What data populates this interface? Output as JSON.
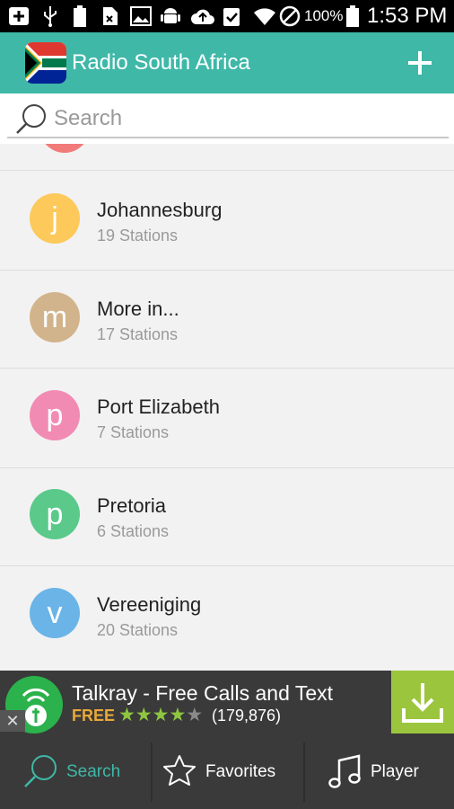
{
  "status_bar": {
    "battery_percent": "100%",
    "time": "1:53 PM"
  },
  "app": {
    "title": "Radio South Africa",
    "accent_color": "#3fb8a8"
  },
  "search": {
    "placeholder": "Search"
  },
  "cities": [
    {
      "letter": "j",
      "name": "Johannesburg",
      "count": "19 Stations",
      "color": "#fcc95a"
    },
    {
      "letter": "m",
      "name": "More in...",
      "count": "17 Stations",
      "color": "#d2b48c"
    },
    {
      "letter": "p",
      "name": "Port Elizabeth",
      "count": "7 Stations",
      "color": "#f28bb3"
    },
    {
      "letter": "p",
      "name": "Pretoria",
      "count": "6 Stations",
      "color": "#5ac98a"
    },
    {
      "letter": "v",
      "name": "Vereeniging",
      "count": "20 Stations",
      "color": "#6ab4e8"
    }
  ],
  "ad": {
    "title": "Talkray - Free Calls and Text",
    "price": "FREE",
    "rating_stars": 4,
    "rating_count": "(179,876)",
    "close_label": "✕"
  },
  "tabs": {
    "search": "Search",
    "favorites": "Favorites",
    "player": "Player",
    "active_color": "#3fb8a8"
  }
}
